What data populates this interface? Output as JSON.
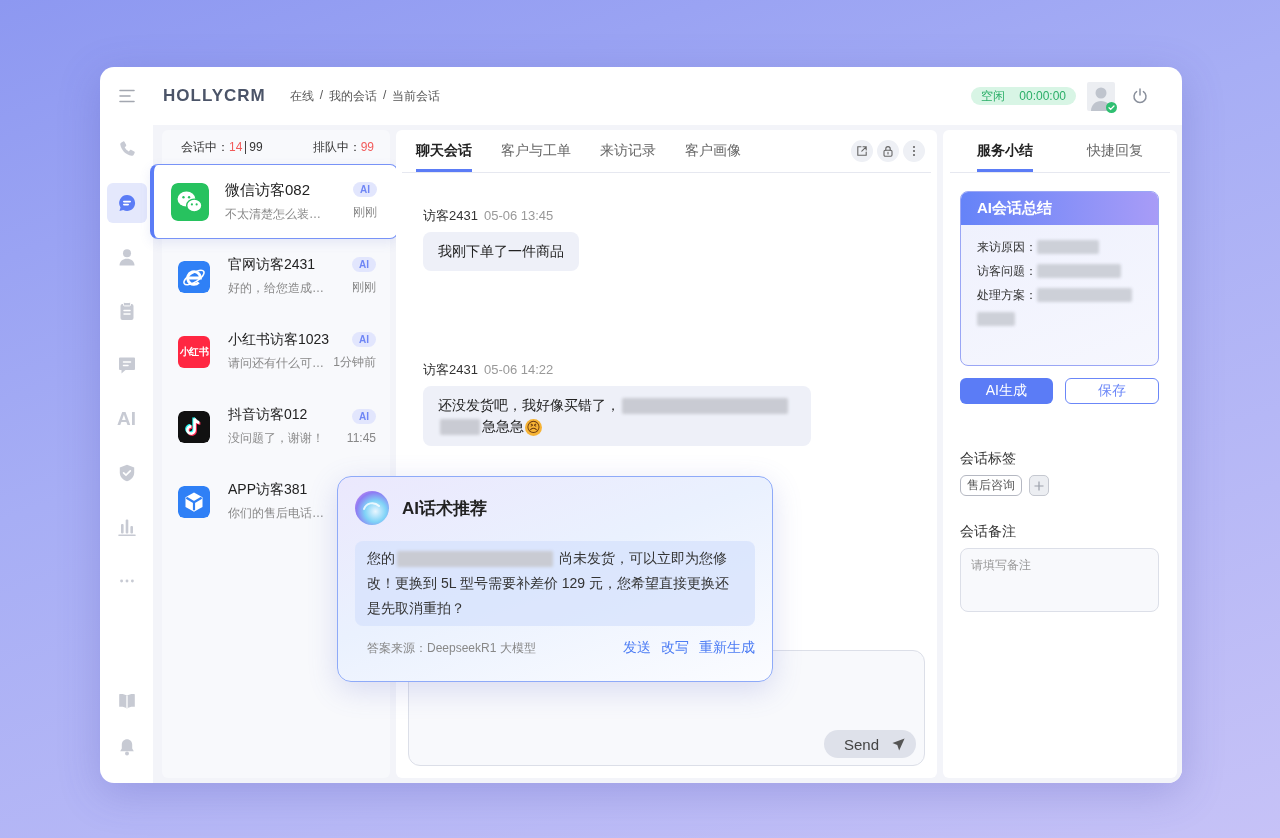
{
  "header": {
    "logo": "HOLLYCRM",
    "breadcrumb": [
      "在线",
      "我的会话",
      "当前会话"
    ],
    "breadcrumb_separator": "/",
    "status": "空闲",
    "timer": "00:00:00"
  },
  "nav": {
    "items": [
      {
        "kind": "phone",
        "selected": false
      },
      {
        "kind": "chat",
        "selected": true
      },
      {
        "kind": "person",
        "selected": false
      },
      {
        "kind": "clipboard",
        "selected": false
      },
      {
        "kind": "comment",
        "selected": false
      },
      {
        "kind": "text",
        "label": "AI",
        "selected": false
      },
      {
        "kind": "shield",
        "selected": false
      },
      {
        "kind": "chart",
        "selected": false
      },
      {
        "kind": "more",
        "selected": false
      }
    ],
    "bottom": [
      {
        "kind": "book",
        "selected": false
      },
      {
        "kind": "bell",
        "selected": false
      }
    ]
  },
  "queue": {
    "active_label": "会话中：",
    "active_count": "14",
    "active_total": "99",
    "waiting_label": "排队中：",
    "waiting_count": "99"
  },
  "conversations": [
    {
      "kind": "bubbles",
      "name": "微信访客082",
      "preview": "不太清楚怎么装…",
      "badge": "AI",
      "time": "刚刚",
      "selected": true
    },
    {
      "kind": "browser",
      "name": "官网访客2431",
      "preview": "好的，给您造成…",
      "badge": "AI",
      "time": "刚刚",
      "selected": false
    },
    {
      "kind": "text_logo",
      "logo_text": "小红书",
      "name": "小红书访客1023",
      "preview": "请问还有什么可…",
      "badge": "AI",
      "time": "1分钟前",
      "selected": false
    },
    {
      "kind": "note",
      "name": "抖音访客012",
      "preview": "没问题了，谢谢！",
      "badge": "AI",
      "time": "11:45",
      "selected": false
    },
    {
      "kind": "cube",
      "name": "APP访客381",
      "preview": "你们的售后电话…",
      "selected": false
    }
  ],
  "chat": {
    "tabs": [
      {
        "label": "聊天会话",
        "selected": true
      },
      {
        "label": "客户与工单",
        "selected": false
      },
      {
        "label": "来访记录",
        "selected": false
      },
      {
        "label": "客户画像",
        "selected": false
      }
    ],
    "messages": [
      {
        "sender": "访客2431",
        "time": "05-06 13:45",
        "parts": [
          {
            "kind": "text",
            "text": "我刚下单了一件商品"
          }
        ]
      },
      {
        "sender": "访客2431",
        "time": "05-06 14:22",
        "parts": [
          {
            "kind": "text",
            "text": "还没发货吧，我好像买错了，"
          },
          {
            "kind": "redacted_long"
          },
          {
            "kind": "redacted_short"
          },
          {
            "kind": "text",
            "text": "急急急"
          },
          {
            "kind": "emoji",
            "text": "😣"
          }
        ]
      }
    ],
    "send_label": "Send"
  },
  "suggestion": {
    "title": "AI话术推荐",
    "parts": [
      {
        "kind": "text",
        "text": "您的"
      },
      {
        "kind": "redacted_long"
      },
      {
        "kind": "text",
        "text": " 尚未发货，可以立即为您修改！更换到 5L 型号需要补差价 129 元，您希望直接更换还是先取消重拍？"
      }
    ],
    "source": "答案来源：DeepseekR1 大模型",
    "actions": [
      "发送",
      "改写",
      "重新生成"
    ]
  },
  "summary": {
    "tabs": [
      {
        "label": "服务小结",
        "selected": true
      },
      {
        "label": "快捷回复",
        "selected": false
      }
    ],
    "card_title": "AI会话总结",
    "fields": [
      {
        "kind": "medium",
        "label": "来访原因："
      },
      {
        "kind": "long",
        "label": "访客问题："
      },
      {
        "kind": "wrapped",
        "label": "处理方案："
      }
    ],
    "generate_label": "AI生成",
    "save_label": "保存",
    "tags_heading": "会话标签",
    "tags": [
      "售后咨询"
    ],
    "notes_heading": "会话备注",
    "notes_placeholder": "请填写备注"
  }
}
